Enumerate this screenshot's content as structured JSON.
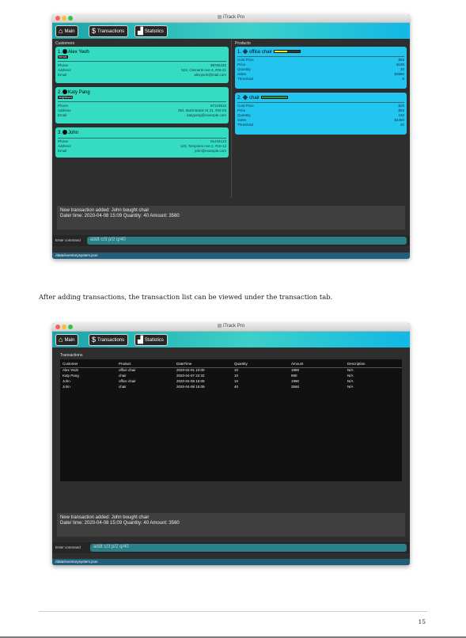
{
  "window": {
    "title": "iTrack Pro"
  },
  "tabs": [
    {
      "label": "Main"
    },
    {
      "label": "Transactions"
    },
    {
      "label": "Statistics"
    }
  ],
  "customers_header": "Customers",
  "products_header": "Products",
  "customers": [
    {
      "index": "1.",
      "name": "Alex Yeoh",
      "tag": "friends",
      "phone": "98765432",
      "address": "523, Clementi Ave 4, #06-21",
      "email": "alexyeoh@mail.com"
    },
    {
      "index": "2.",
      "name": "Katy Pang",
      "tag": "neighbours",
      "phone": "87123612",
      "address": "354, Bukit Batok St 31, #04-03",
      "email": "katypang@example.com"
    },
    {
      "index": "3.",
      "name": "John",
      "tag": "",
      "phone": "91234123",
      "address": "123, Tampines Ave 2, #10-12",
      "email": "john@example.com"
    }
  ],
  "customer_field_labels": {
    "phone": "Phone",
    "address": "Address",
    "email": "Email"
  },
  "products": [
    {
      "index": "1.",
      "name": "office chair",
      "cost_price": "$69",
      "price": "$199",
      "quantity": "20",
      "sales": "$3980",
      "threshold": "8",
      "stock_level": 0.5,
      "stock_color": "#f2e51a"
    },
    {
      "index": "2.",
      "name": "chair",
      "cost_price": "$20",
      "price": "$89",
      "quantity": "150",
      "sales": "$4450",
      "threshold": "40",
      "stock_level": 1.0,
      "stock_color": "#2f9a3c"
    }
  ],
  "product_field_labels": {
    "cost_price": "Cost Price",
    "price": "Price",
    "quantity": "Quantity",
    "sales": "Sales",
    "threshold": "Threshold"
  },
  "result_message": {
    "line1": "New transaction added: John bought chair",
    "line2": "Date/ time: 2020-04-08 15:09 Quantity: 40 Amount: 3560"
  },
  "command": {
    "label": "Enter command",
    "value": "addt c/3 p/2 q/40"
  },
  "status_path": "./data/inventorysystem.json",
  "caption": "After adding transactions, the transaction list can be viewed under the transaction tab.",
  "transactions_header": "Transactions",
  "transaction_columns": [
    "Customer",
    "Product",
    "DateTime",
    "Quantity",
    "Amount",
    "Description"
  ],
  "transactions": [
    {
      "customer": "Alex Yeoh",
      "product": "office chair",
      "datetime": "2020-04-01 10:00",
      "quantity": "10",
      "amount": "1990",
      "description": "N/A"
    },
    {
      "customer": "Katy Pang",
      "product": "chair",
      "datetime": "2020-04-07 22:32",
      "quantity": "10",
      "amount": "890",
      "description": "N/A"
    },
    {
      "customer": "John",
      "product": "office chair",
      "datetime": "2020-04-08 15:09",
      "quantity": "10",
      "amount": "1990",
      "description": "N/A"
    },
    {
      "customer": "John",
      "product": "chair",
      "datetime": "2020-04-08 15:09",
      "quantity": "40",
      "amount": "3560",
      "description": "N/A"
    }
  ],
  "page_number": "15"
}
